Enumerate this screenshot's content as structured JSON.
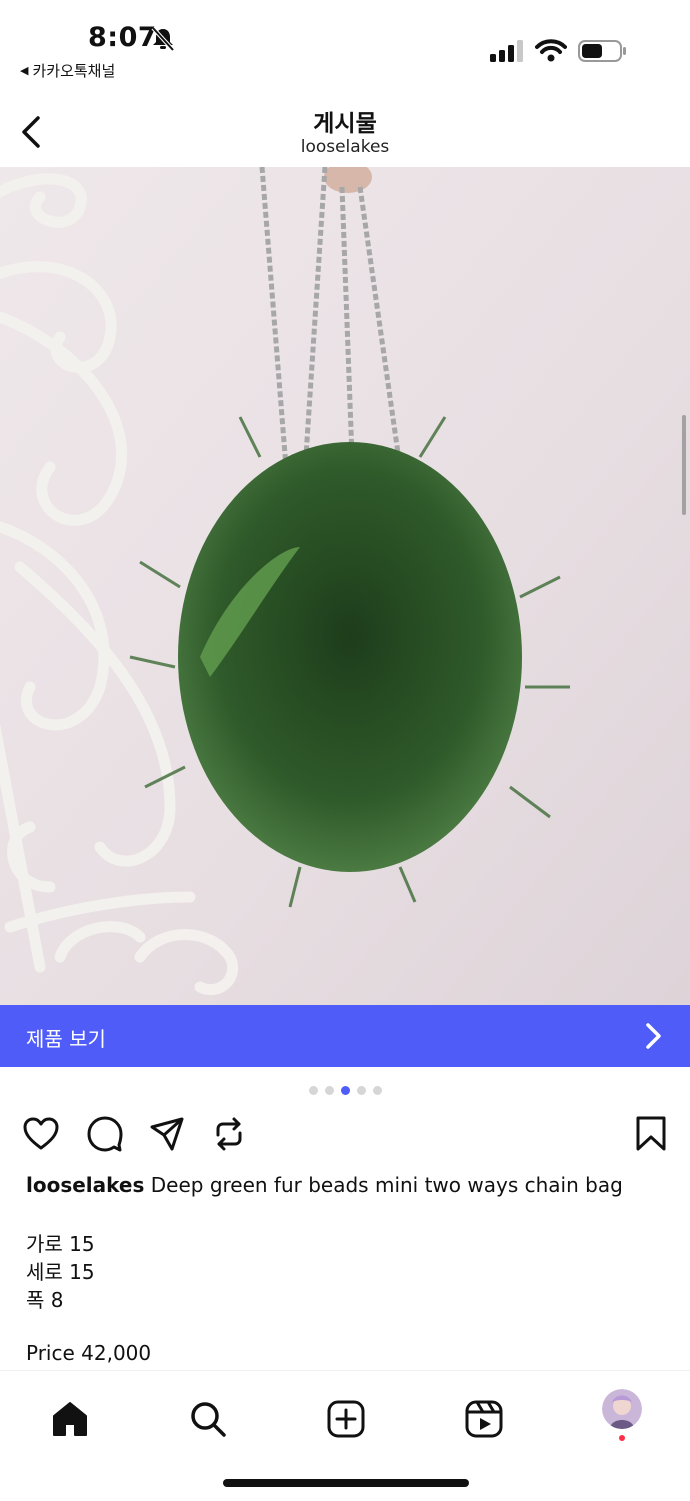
{
  "status_bar": {
    "time": "8:07",
    "back_app": "카카오톡채널"
  },
  "header": {
    "title": "게시물",
    "subtitle": "looselakes"
  },
  "product_banner": {
    "label": "제품 보기"
  },
  "carousel": {
    "count": 5,
    "active_index": 2
  },
  "post": {
    "username": "looselakes",
    "caption": "Deep green fur beads mini two ways chain bag",
    "specs": [
      "가로 15",
      "세로 15",
      "폭 8"
    ],
    "price": "Price 42,000"
  },
  "icons": {
    "actions": [
      "heart-icon",
      "comment-icon",
      "share-icon",
      "repost-icon",
      "save-icon"
    ],
    "tabs": [
      "home-icon",
      "search-icon",
      "create-icon",
      "reels-icon",
      "profile-avatar"
    ]
  },
  "colors": {
    "accent": "#4f5cf8",
    "notification": "#ff2d45",
    "fur": "#2f5a2a"
  }
}
